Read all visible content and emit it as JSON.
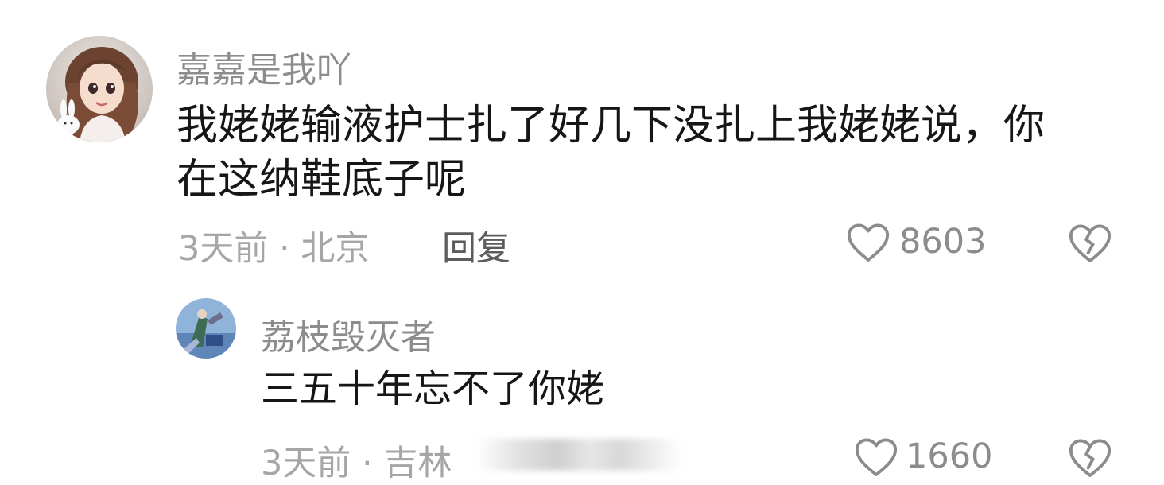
{
  "comments": [
    {
      "username": "嘉嘉是我吖",
      "text": "我姥姥输液护士扎了好几下没扎上我姥姥说，你在这纳鞋底子呢",
      "meta": "3天前 · 北京",
      "reply_label": "回复",
      "likes": "8603",
      "like_icon": "heart-outline-icon",
      "dislike_icon": "broken-heart-icon"
    },
    {
      "username": "荔枝毁灭者",
      "text": "三五十年忘不了你姥",
      "meta": "3天前 · 吉林",
      "likes": "1660",
      "like_icon": "heart-outline-icon",
      "dislike_icon": "broken-heart-icon"
    }
  ],
  "colors": {
    "username": "#8c8c8c",
    "text": "#161616",
    "meta": "#a6a6a6",
    "reply": "#5c5c5c",
    "icon": "#8c8c8c"
  }
}
